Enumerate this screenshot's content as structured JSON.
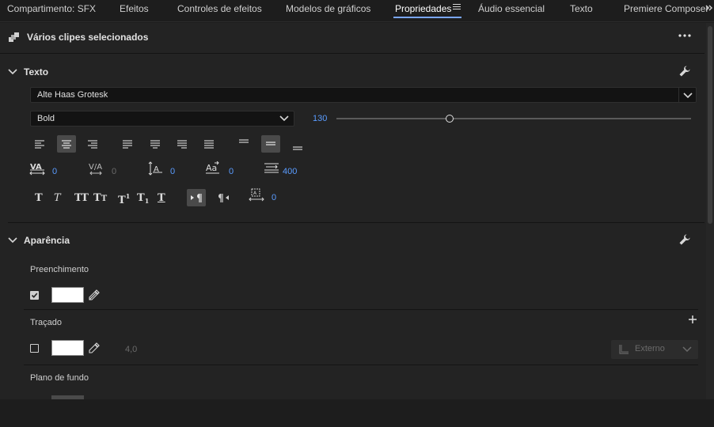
{
  "tabs": [
    {
      "label": "Compartimento: SFX"
    },
    {
      "label": "Efeitos"
    },
    {
      "label": "Controles de efeitos"
    },
    {
      "label": "Modelos de gráficos"
    },
    {
      "label": "Propriedades"
    },
    {
      "label": "Áudio essencial"
    },
    {
      "label": "Texto"
    },
    {
      "label": "Premiere Composer"
    }
  ],
  "active_tab": "Propriedades",
  "header": {
    "title": "Vários clipes selecionados",
    "more_icon": "ellipsis-icon"
  },
  "texto": {
    "title": "Texto",
    "font_family": "Alte Haas Grotesk",
    "font_style": "Bold",
    "font_size": "130",
    "font_size_slider_fraction": 0.32,
    "kerning": "0",
    "tracking": "0",
    "baseline_shift": "0",
    "tsume": "0",
    "leading": "400",
    "indent": "0",
    "icons": {
      "kerning": "kerning-icon",
      "tracking": "tracking-icon",
      "baseline": "baseline-shift-icon",
      "tsume": "tsume-icon",
      "leading": "leading-icon",
      "indent": "indent-icon",
      "wrench": "wrench-icon"
    }
  },
  "aparencia": {
    "title": "Aparência",
    "fill": {
      "label": "Preenchimento",
      "checked": true,
      "color": "#ffffff"
    },
    "stroke": {
      "label": "Traçado",
      "checked": false,
      "color": "#ffffff",
      "width": "4,0",
      "position": "Externo"
    },
    "background": {
      "label": "Plano de fundo"
    }
  },
  "colors": {
    "accent": "#5a9cff",
    "panel": "#232323",
    "tabbar": "#1d1d1d"
  }
}
